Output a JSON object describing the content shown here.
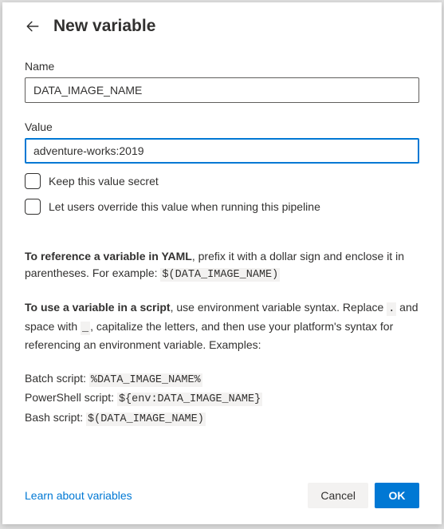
{
  "title": "New variable",
  "fields": {
    "name": {
      "label": "Name",
      "value": "DATA_IMAGE_NAME"
    },
    "value": {
      "label": "Value",
      "value": "adventure-works:2019"
    }
  },
  "checkboxes": {
    "secret": "Keep this value secret",
    "override": "Let users override this value when running this pipeline"
  },
  "help": {
    "yaml_bold": "To reference a variable in YAML",
    "yaml_rest": ", prefix it with a dollar sign and enclose it in parentheses. For example: ",
    "yaml_code": "$(DATA_IMAGE_NAME)",
    "script_bold": "To use a variable in a script",
    "script_rest1": ", use environment variable syntax. Replace ",
    "dot": ".",
    "script_rest2": " and space with ",
    "underscore": "_",
    "script_rest3": ", capitalize the letters, and then use your platform's syntax for referencing an environment variable. Examples:",
    "batch_label": "Batch script: ",
    "batch_code": "%DATA_IMAGE_NAME%",
    "powershell_label": "PowerShell script: ",
    "powershell_code": "${env:DATA_IMAGE_NAME}",
    "bash_label": "Bash script: ",
    "bash_code": "$(DATA_IMAGE_NAME)"
  },
  "footer": {
    "learn": "Learn about variables",
    "cancel": "Cancel",
    "ok": "OK"
  }
}
